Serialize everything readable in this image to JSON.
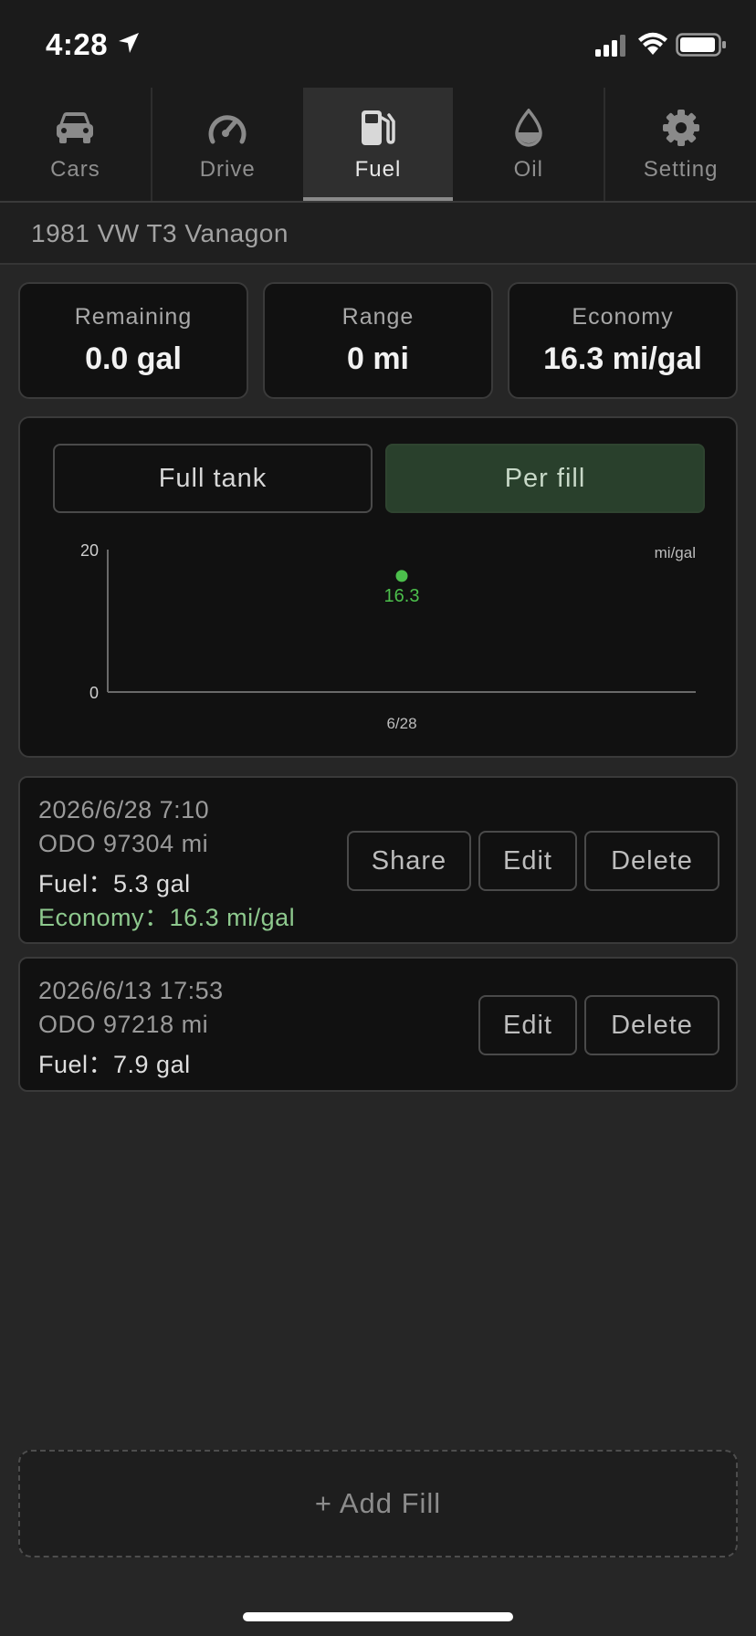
{
  "status_bar": {
    "time": "4:28"
  },
  "tabs": [
    {
      "label": "Cars",
      "icon": "car-icon",
      "active": false
    },
    {
      "label": "Drive",
      "icon": "speedometer-icon",
      "active": false
    },
    {
      "label": "Fuel",
      "icon": "fuel-pump-icon",
      "active": true
    },
    {
      "label": "Oil",
      "icon": "oil-drop-icon",
      "active": false
    },
    {
      "label": "Setting",
      "icon": "gear-icon",
      "active": false
    }
  ],
  "car": {
    "name": "1981 VW T3 Vanagon"
  },
  "stats": [
    {
      "label": "Remaining",
      "value": "0.0 gal"
    },
    {
      "label": "Range",
      "value": "0 mi"
    },
    {
      "label": "Economy",
      "value": "16.3 mi/gal"
    }
  ],
  "chart_toggle": {
    "full_tank_label": "Full tank",
    "per_fill_label": "Per fill",
    "selected": "Per fill"
  },
  "chart_data": {
    "type": "scatter",
    "unit_label": "mi/gal",
    "y_tick_labels": [
      "20",
      "0"
    ],
    "x_tick_labels": [
      "6/28"
    ],
    "ylim": [
      0,
      20
    ],
    "points": [
      {
        "x": "6/28",
        "y": 16.3,
        "label": "16.3"
      }
    ],
    "point_color": "#4cbf4c",
    "grid": false
  },
  "entries": [
    {
      "date": "2026/6/28 7:10",
      "odo": "ODO 97304 mi",
      "fuel": "Fuel：5.3 gal",
      "economy": "Economy：16.3 mi/gal",
      "actions": {
        "share": "Share",
        "edit": "Edit",
        "delete": "Delete"
      }
    },
    {
      "date": "2026/6/13 17:53",
      "odo": "ODO 97218 mi",
      "fuel": "Fuel：7.9 gal",
      "actions": {
        "edit": "Edit",
        "delete": "Delete"
      }
    }
  ],
  "add_fill_label": "+ Add Fill",
  "colors": {
    "accent_green": "#8ec98e",
    "selected_toggle_bg": "#29402c",
    "background": "#262626",
    "card_bg": "#111111"
  }
}
